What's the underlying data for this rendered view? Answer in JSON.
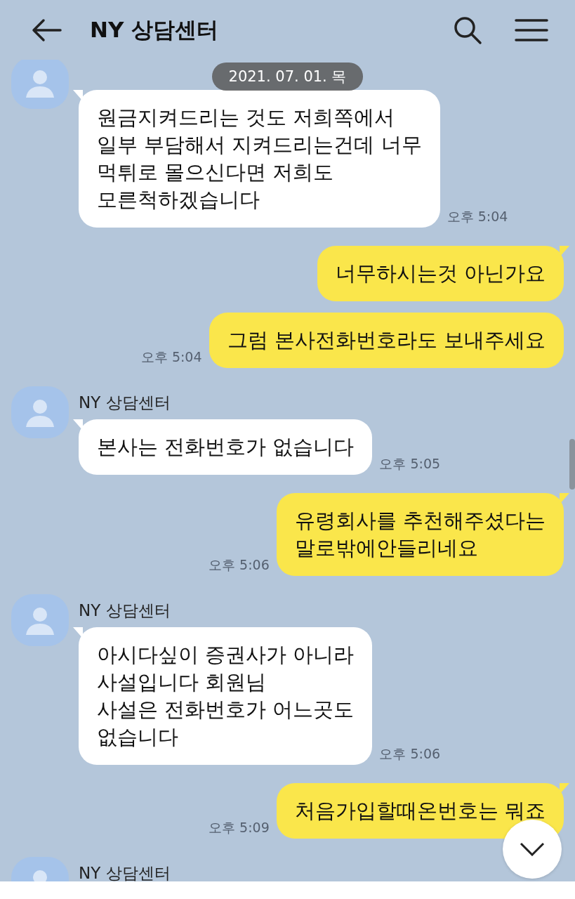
{
  "header": {
    "title": "NY 상담센터"
  },
  "date_pill": "2021. 07. 01. 목",
  "groups": [
    {
      "kind": "received",
      "messages": [
        {
          "text": "원금지켜드리는 것도 저희쪽에서\n일부 부담해서 지켜드리는건데 너무\n먹튀로 몰으신다면 저희도\n모른척하겠습니다",
          "time": "오후 5:04"
        }
      ]
    },
    {
      "kind": "sent",
      "messages": [
        {
          "text": "너무하시는것 아닌가요"
        },
        {
          "text": "그럼 본사전화번호라도 보내주세요",
          "time": "오후 5:04"
        }
      ]
    },
    {
      "kind": "received",
      "name": "NY 상담센터",
      "messages": [
        {
          "text": "본사는 전화번호가 없습니다",
          "time": "오후 5:05"
        }
      ]
    },
    {
      "kind": "sent",
      "messages": [
        {
          "text": "유령회사를 추천해주셨다는\n말로밖에안들리네요",
          "time": "오후 5:06"
        }
      ]
    },
    {
      "kind": "received",
      "name": "NY 상담센터",
      "messages": [
        {
          "text": "아시다싶이 증권사가 아니라\n사설입니다 회원님\n사설은 전화번호가 어느곳도\n없습니다",
          "time": "오후 5:06"
        }
      ]
    },
    {
      "kind": "sent",
      "messages": [
        {
          "text": "처음가입할때온번호는 뭐죠",
          "time": "오후 5:09"
        }
      ]
    },
    {
      "kind": "received",
      "name": "NY 상담센터"
    }
  ]
}
